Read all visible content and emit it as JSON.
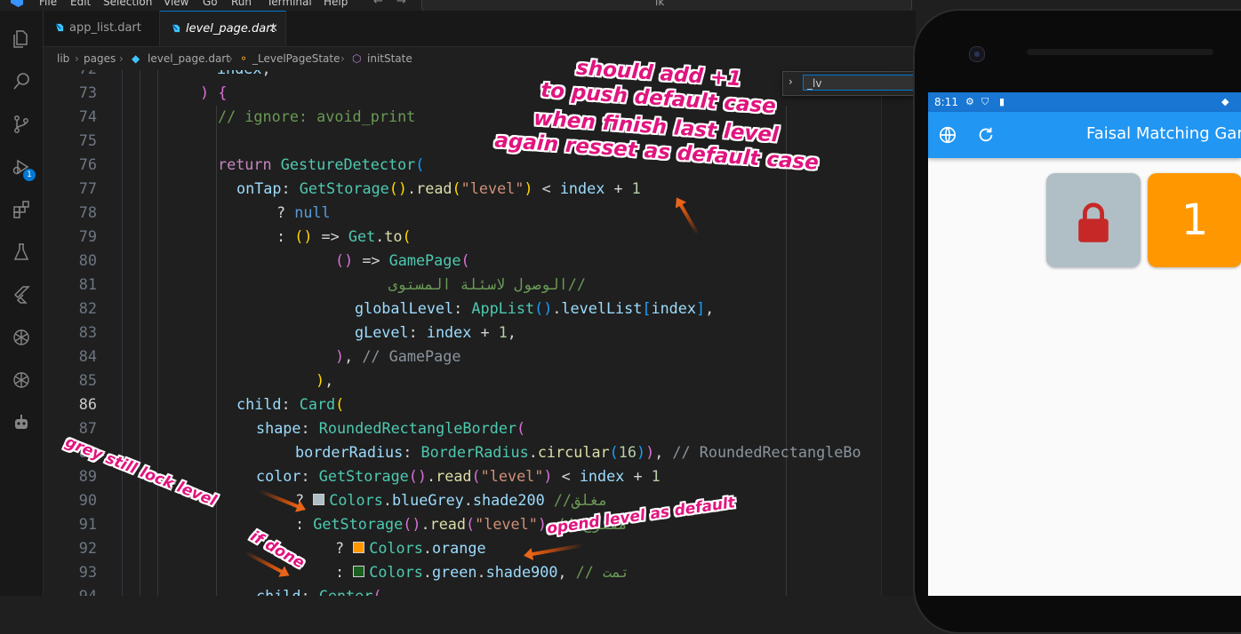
{
  "menubar": {
    "items": [
      "File",
      "Edit",
      "Selection",
      "View",
      "Go",
      "Run",
      "Terminal",
      "Help"
    ],
    "search_text": "lk"
  },
  "tabs": [
    {
      "label": "app_list.dart",
      "active": false
    },
    {
      "label": "level_page.dart",
      "active": true
    }
  ],
  "breadcrumb": [
    "lib",
    "pages",
    "level_page.dart",
    "_LevelPageState",
    "initState"
  ],
  "activity_badge": "1",
  "find_widget": {
    "value": "_lv"
  },
  "editor": {
    "current_line": 86,
    "lines": [
      {
        "n": "72",
        "text": "index,"
      },
      {
        "n": "73",
        "text": ") {"
      },
      {
        "n": "74",
        "text": "// ignore: avoid_print"
      },
      {
        "n": "75",
        "text": ""
      },
      {
        "n": "76",
        "text": "return GestureDetector("
      },
      {
        "n": "77",
        "text": "onTap: GetStorage().read(\"level\") < index + 1"
      },
      {
        "n": "78",
        "text": "? null"
      },
      {
        "n": "79",
        "text": ": () => Get.to("
      },
      {
        "n": "80",
        "text": "() => GamePage("
      },
      {
        "n": "81",
        "text": "//الوصول لاسئلة المستوى"
      },
      {
        "n": "82",
        "text": "globalLevel: AppList().levelList[index],"
      },
      {
        "n": "83",
        "text": "gLevel: index + 1,"
      },
      {
        "n": "84",
        "text": "), // GamePage"
      },
      {
        "n": "85",
        "text": "),"
      },
      {
        "n": "86",
        "text": "child: Card("
      },
      {
        "n": "87",
        "text": "shape: RoundedRectangleBorder("
      },
      {
        "n": "88",
        "text": "borderRadius: BorderRadius.circular(16)), // RoundedRectangleBo"
      },
      {
        "n": "89",
        "text": "color: GetStorage().read(\"level\") < index + 1"
      },
      {
        "n": "90",
        "text": "? Colors.blueGrey.shade200 //مغلق"
      },
      {
        "n": "91",
        "text": ": GetStorage().read(\"level\") // مفتوح"
      },
      {
        "n": "92",
        "text": "? Colors.orange"
      },
      {
        "n": "93",
        "text": ": Colors.green.shade900, // تمت"
      },
      {
        "n": "94",
        "text": "child: Center("
      }
    ],
    "swatches": {
      "blueGrey200": "#b0bec5",
      "orange": "#ff9800",
      "green900": "#1b5e20"
    }
  },
  "phone": {
    "status_time": "8:11",
    "app_title": "Faisal Matching Game",
    "cards": [
      {
        "state": "locked",
        "icon": "lock-icon",
        "color": "#b0bec5",
        "lock_color": "#c62828"
      },
      {
        "state": "open",
        "label": "1",
        "color": "#ff9800"
      }
    ]
  },
  "annotations": {
    "top": [
      "should add +1",
      "to push   default case",
      "when finish last level",
      "again  resset as default case"
    ],
    "grey": "grey still lock level",
    "done": "if done",
    "open": "opend level as  default"
  }
}
